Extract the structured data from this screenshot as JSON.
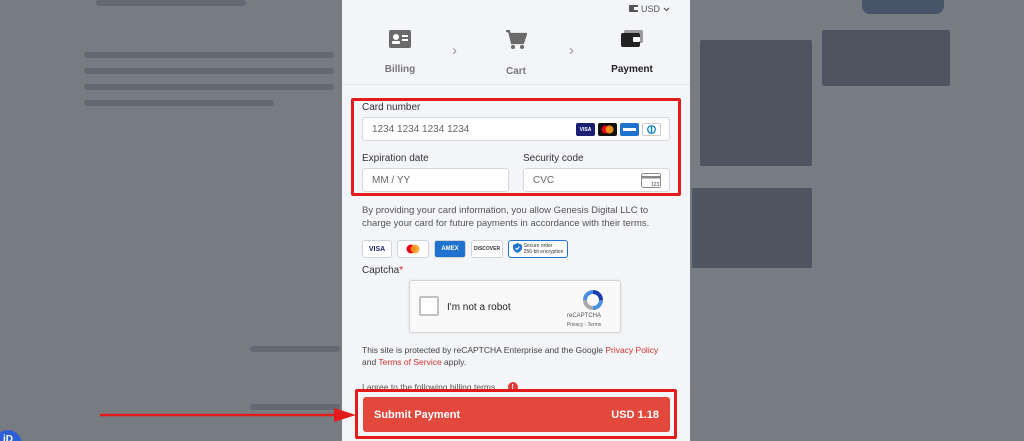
{
  "currency": {
    "label": "USD"
  },
  "steps": [
    {
      "label": "Billing",
      "icon": "id-card-icon"
    },
    {
      "label": "Cart",
      "icon": "cart-icon"
    },
    {
      "label": "Payment",
      "icon": "wallet-icon"
    }
  ],
  "card": {
    "number_label": "Card number",
    "number_placeholder": "1234 1234 1234 1234",
    "brands": [
      "VISA",
      "mastercard",
      "amex",
      "diners"
    ],
    "expiry_label": "Expiration date",
    "expiry_placeholder": "MM / YY",
    "cvc_label": "Security code",
    "cvc_placeholder": "CVC",
    "cvc_icon_text": "123"
  },
  "consent_text": "By providing your card information, you allow Genesis Digital LLC to charge your card for future payments in accordance with their terms.",
  "badges": [
    "VISA",
    "mastercard",
    "AMEX",
    "DISCOVER",
    "Secure order",
    "256-bit encryption"
  ],
  "captcha": {
    "label": "Captcha",
    "required_mark": "*",
    "checkbox_text": "I'm not a robot",
    "brand": "reCAPTCHA",
    "links": "Privacy - Terms"
  },
  "protection": {
    "prefix": "This site is protected by reCAPTCHA Enterprise and the Google ",
    "privacy_link": "Privacy Policy",
    "and": " and ",
    "terms_link": "Terms of Service",
    "suffix": " apply."
  },
  "agree_text": "I agree to the following billing terms.",
  "agree_info": "!",
  "submit": {
    "label": "Submit Payment",
    "amount": "USD 1.18"
  },
  "corner_badge": "iD",
  "colors": {
    "accent": "#e2483c",
    "highlight": "#e31b1b"
  }
}
